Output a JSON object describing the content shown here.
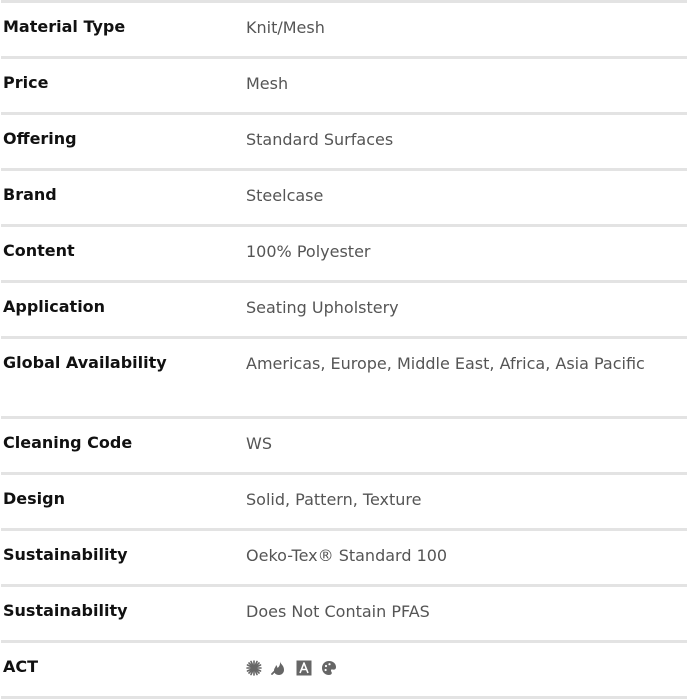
{
  "specs": [
    {
      "label": "Material Type",
      "value": "Knit/Mesh"
    },
    {
      "label": "Price",
      "value": "Mesh"
    },
    {
      "label": "Offering",
      "value": "Standard Surfaces"
    },
    {
      "label": "Brand",
      "value": "Steelcase"
    },
    {
      "label": "Content",
      "value": "100% Polyester"
    },
    {
      "label": "Application",
      "value": "Seating Upholstery"
    },
    {
      "label": "Global Availability",
      "value": "Americas, Europe, Middle East, Africa, Asia Pacific"
    },
    {
      "label": "Cleaning Code",
      "value": "WS"
    },
    {
      "label": "Design",
      "value": "Solid, Pattern, Texture"
    },
    {
      "label": "Sustainability",
      "value": "Oeko-Tex® Standard 100"
    },
    {
      "label": "Sustainability",
      "value": "Does Not Contain PFAS"
    },
    {
      "label": "ACT",
      "icons": [
        "lightfastness-icon",
        "flammability-icon",
        "abrasion-icon",
        "colorfastness-icon"
      ]
    }
  ],
  "colors": {
    "label": "#111111",
    "value": "#555555",
    "divider": "#e3e3e3",
    "icon": "#666666"
  }
}
